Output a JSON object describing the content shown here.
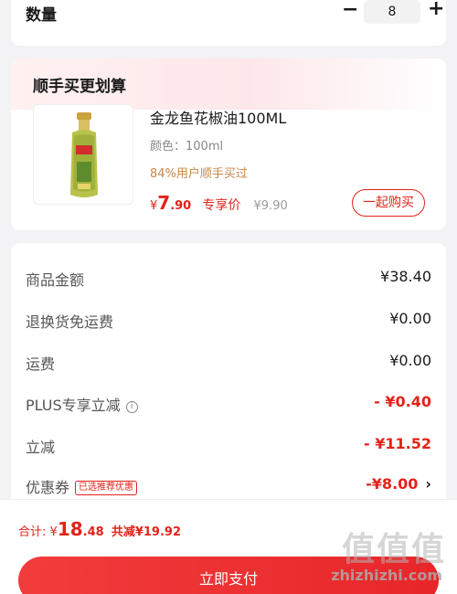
{
  "quantity": {
    "label": "数量",
    "minus": "−",
    "value": "8",
    "plus": "+"
  },
  "bundle": {
    "title": "顺手买更划算",
    "product": {
      "name": "金龙鱼花椒油100ML",
      "color": "颜色：100ml",
      "buyers": "84%用户顺手买过",
      "price_symbol": "¥",
      "price_int": "7",
      "price_dec": ".90",
      "price_tag": "专享价",
      "original_price": "¥9.90",
      "buy_button": "一起购买",
      "image_icon": "oil-bottle-icon"
    }
  },
  "summary": {
    "rows": [
      {
        "label": "商品金额",
        "value": "¥38.40"
      },
      {
        "label": "退换货免运费",
        "value": "¥0.00"
      },
      {
        "label": "运费",
        "value": "¥0.00"
      },
      {
        "label": "PLUS专享立减",
        "value": "- ¥0.40"
      },
      {
        "label": "立减",
        "value": "- ¥11.52"
      },
      {
        "label": "优惠券",
        "value": "-¥8.00",
        "badge": "已选推荐优惠"
      }
    ]
  },
  "footer": {
    "total_label": "合计:",
    "total_symbol": "¥",
    "total_int": "18",
    "total_dec": ".48",
    "saving": "共减¥19.92",
    "pay_button": "立即支付"
  },
  "watermark": {
    "text": "值值值",
    "url": "zhizhizhi.com"
  },
  "colors": {
    "accent": "#e2231a",
    "muted": "#888888",
    "buyers": "#c9864a"
  }
}
